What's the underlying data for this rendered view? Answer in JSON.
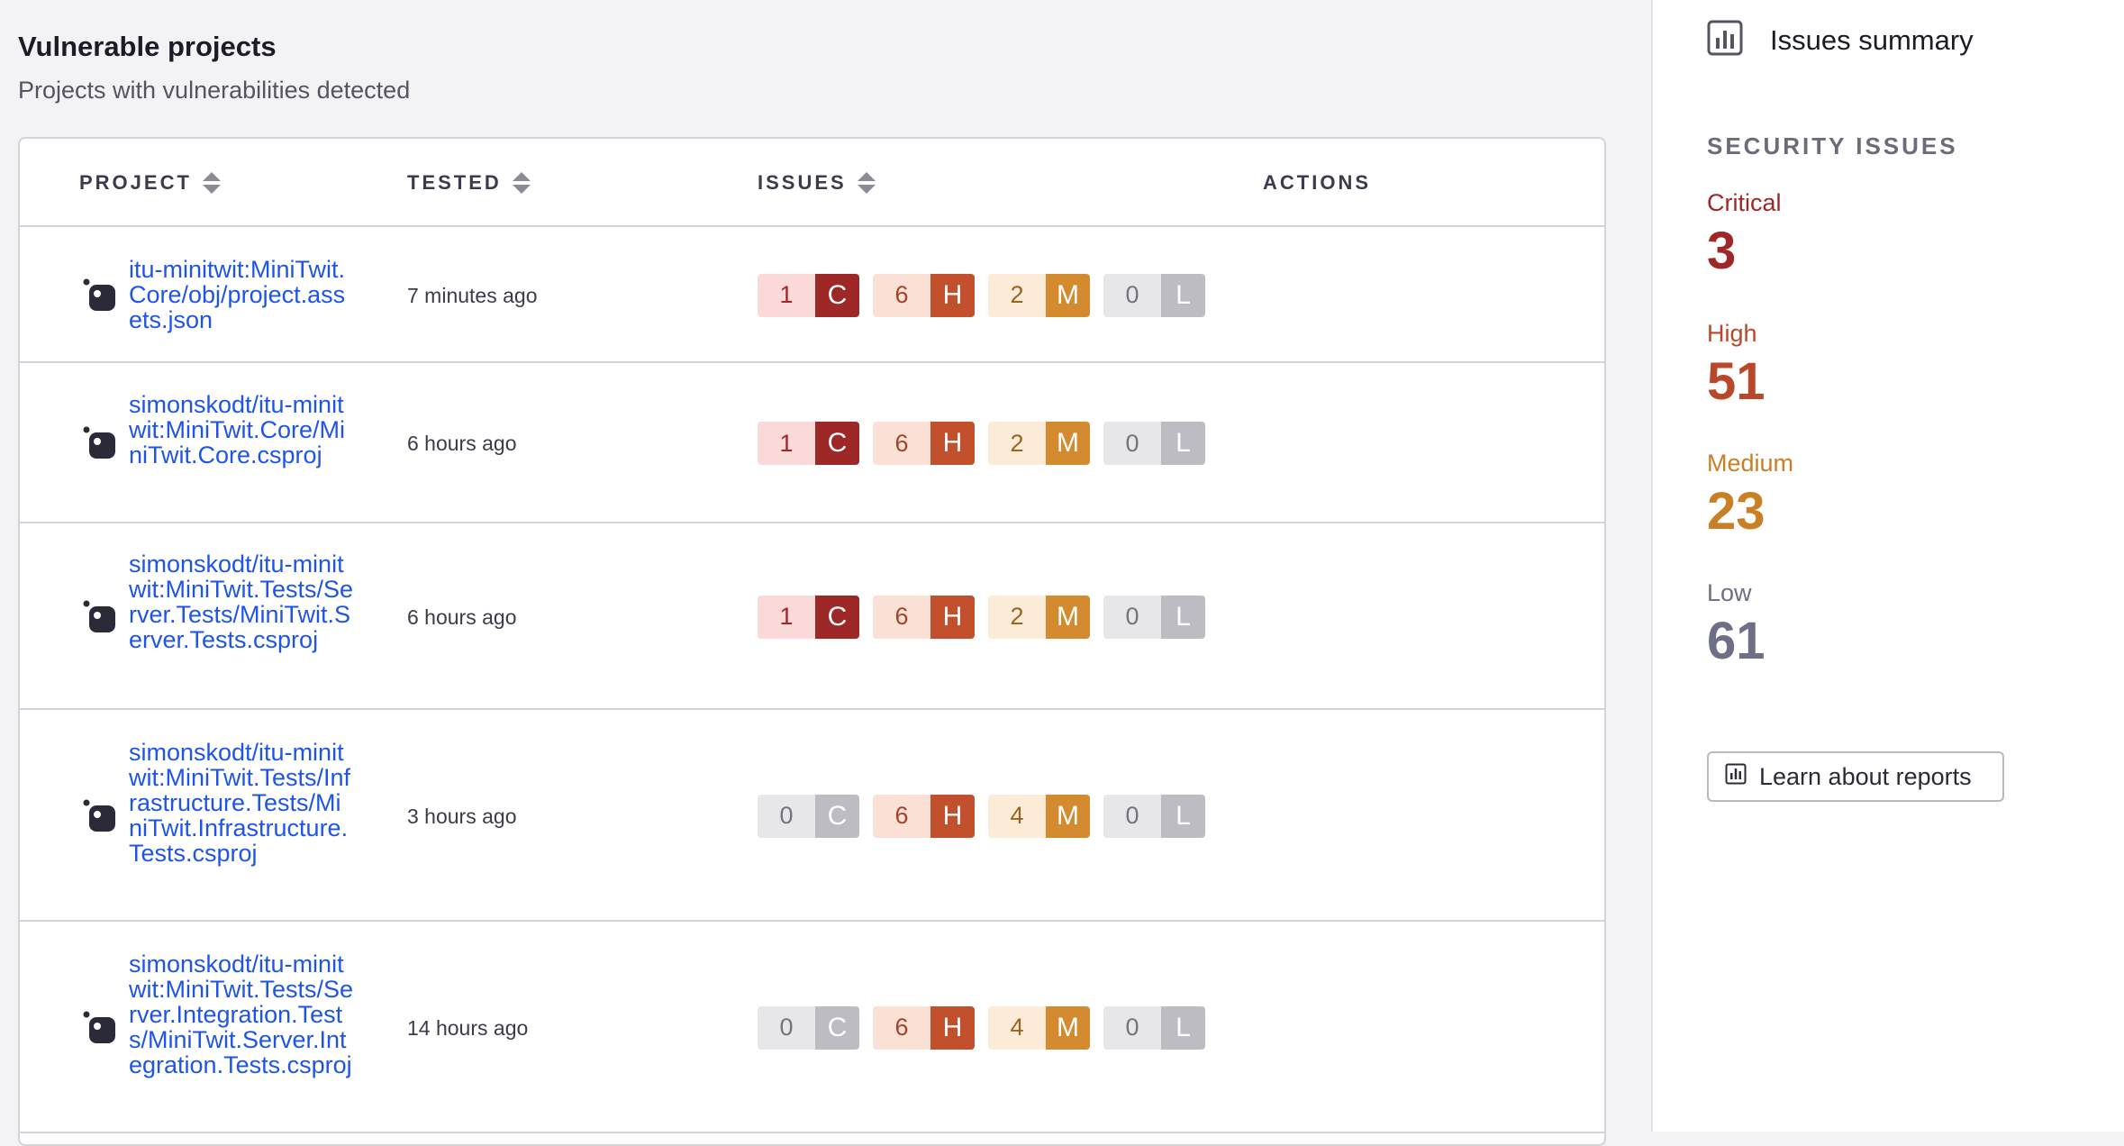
{
  "main": {
    "title": "Vulnerable projects",
    "subtitle": "Projects with vulnerabilities detected",
    "table": {
      "headers": {
        "project": "PROJECT",
        "tested": "TESTED",
        "issues": "ISSUES",
        "actions": "ACTIONS"
      },
      "rows": [
        {
          "project": "itu-minitwit:MiniTwit.Core/obj/project.assets.json",
          "tested": "7 minutes ago",
          "issues": [
            {
              "count": "1",
              "letter": "C"
            },
            {
              "count": "6",
              "letter": "H"
            },
            {
              "count": "2",
              "letter": "M"
            },
            {
              "count": "0",
              "letter": "L"
            }
          ]
        },
        {
          "project": "simonskodt/itu-minitwit:MiniTwit.Core/MiniTwit.Core.csproj",
          "tested": "6 hours ago",
          "issues": [
            {
              "count": "1",
              "letter": "C"
            },
            {
              "count": "6",
              "letter": "H"
            },
            {
              "count": "2",
              "letter": "M"
            },
            {
              "count": "0",
              "letter": "L"
            }
          ]
        },
        {
          "project": "simonskodt/itu-minitwit:MiniTwit.Tests/Server.Tests/MiniTwit.Server.Tests.csproj",
          "tested": "6 hours ago",
          "issues": [
            {
              "count": "1",
              "letter": "C"
            },
            {
              "count": "6",
              "letter": "H"
            },
            {
              "count": "2",
              "letter": "M"
            },
            {
              "count": "0",
              "letter": "L"
            }
          ]
        },
        {
          "project": "simonskodt/itu-minitwit:MiniTwit.Tests/Infrastructure.Tests/MiniTwit.Infrastructure.Tests.csproj",
          "tested": "3 hours ago",
          "issues": [
            {
              "count": "0",
              "letter": "C"
            },
            {
              "count": "6",
              "letter": "H"
            },
            {
              "count": "4",
              "letter": "M"
            },
            {
              "count": "0",
              "letter": "L"
            }
          ]
        },
        {
          "project": "simonskodt/itu-minitwit:MiniTwit.Tests/Server.Integration.Tests/MiniTwit.Server.Integration.Tests.csproj",
          "tested": "14 hours ago",
          "issues": [
            {
              "count": "0",
              "letter": "C"
            },
            {
              "count": "6",
              "letter": "H"
            },
            {
              "count": "4",
              "letter": "M"
            },
            {
              "count": "0",
              "letter": "L"
            }
          ]
        }
      ]
    }
  },
  "sidebar": {
    "icon": "bar-chart-icon",
    "title": "Issues summary",
    "section_heading": "SECURITY ISSUES",
    "severities": [
      {
        "label": "Critical",
        "count": "3",
        "color": "#9e2727"
      },
      {
        "label": "High",
        "count": "51",
        "color": "#b9472a"
      },
      {
        "label": "Medium",
        "count": "23",
        "color": "#c97f26"
      },
      {
        "label": "Low",
        "count": "61",
        "color": "#6e6e86"
      }
    ],
    "learn_button": "Learn about reports"
  }
}
